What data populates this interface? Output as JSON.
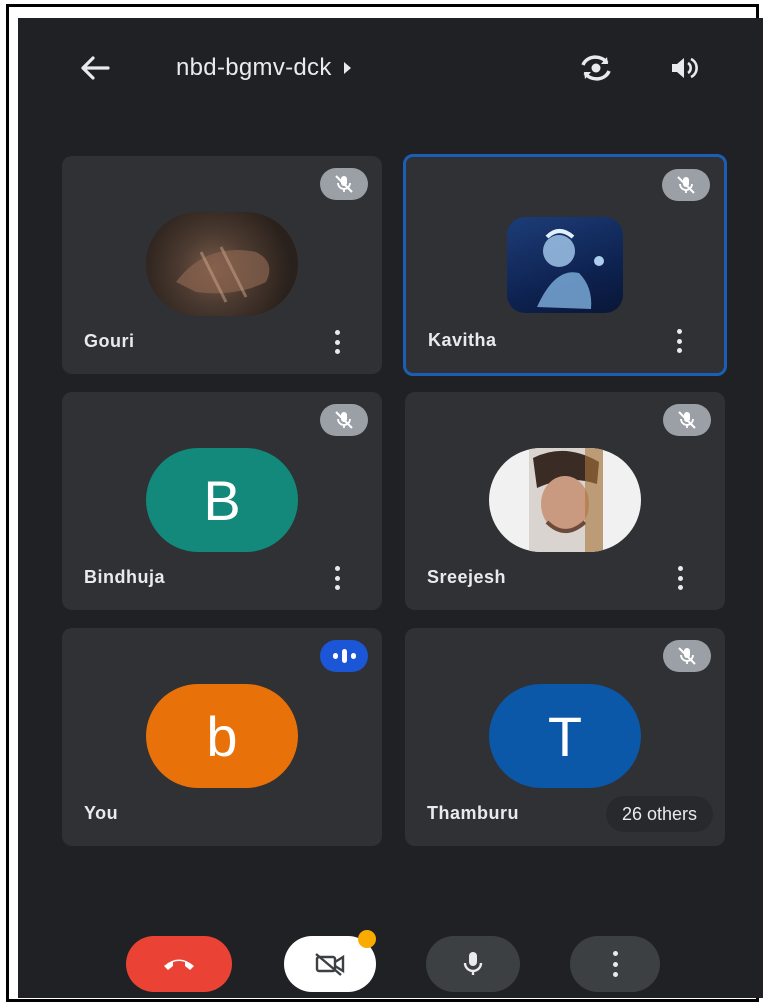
{
  "header": {
    "meeting_code": "nbd-bgmv-dck"
  },
  "participants": [
    {
      "name": "Gouri",
      "avatar": "photo",
      "state": "muted"
    },
    {
      "name": "Kavitha",
      "avatar": "photo",
      "state": "muted",
      "active": true
    },
    {
      "name": "Bindhuja",
      "avatar_letter": "B",
      "avatar_color": "#12897a",
      "state": "muted"
    },
    {
      "name": "Sreejesh",
      "avatar": "photo",
      "state": "muted"
    },
    {
      "name": "You",
      "avatar_letter": "b",
      "avatar_color": "#e8710a",
      "state": "speaking"
    },
    {
      "name": "Thamburu",
      "avatar_letter": "T",
      "avatar_color": "#0b57a8",
      "state": "muted"
    }
  ],
  "others_label": "26 others",
  "colors": {
    "background": "#202124",
    "tile": "#303134",
    "hangup": "#ea4335",
    "active_border": "#1a5fb4",
    "speaking": "#1a56d6"
  },
  "controls": {
    "hangup_icon": "phone-hangup-icon",
    "camera_icon": "camera-off-icon",
    "mic_icon": "mic-icon",
    "more_icon": "more-vertical-icon"
  }
}
